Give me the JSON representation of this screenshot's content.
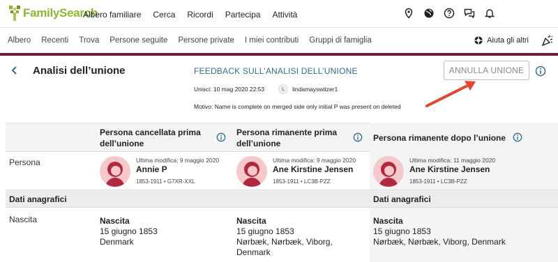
{
  "brand": {
    "name": "FamilySearch",
    "color": "#8cb92b"
  },
  "top_menu": [
    "Albero familiare",
    "Cerca",
    "Ricordi",
    "Partecipa",
    "Attività"
  ],
  "top_icons": [
    "location-icon",
    "globe-icon",
    "help-icon",
    "chat-icon",
    "bell-icon"
  ],
  "sub_menu": [
    "Albero",
    "Recenti",
    "Trova",
    "Persone seguite",
    "Persone private",
    "I miei contributi",
    "Gruppi di famiglia"
  ],
  "help_others": "Aiuta gli altri",
  "page": {
    "title": "Analisi dell’unione",
    "feedback_link": "FEEDBACK SULL’ANALISI DELL’UNIONE",
    "undo_button": "ANNULLA UNIONE",
    "merged_label": "Unisci: 10 mag 2020 22:53",
    "user_initial": "L",
    "user_name": "lindamayswitzer1",
    "reason": "Motivo: Name is complete on merged side only initial P was present on deleted"
  },
  "table": {
    "columns": [
      "Persona cancellata prima dell’unione",
      "Persona rimanente prima dell’unione",
      "Persona rimanente dopo l’unione"
    ],
    "row_person_label": "Persona",
    "persons": [
      {
        "modified": "Ultima modifica: 9 maggio 2020",
        "name": "Annie P",
        "ids": "1853-1911 • G7XR-XXL"
      },
      {
        "modified": "Ultima modifica: 9 maggio 2020",
        "name": "Ane Kirstine Jensen",
        "ids": "1853-1911 • LC3B-PZZ"
      },
      {
        "modified": "Ultima modifica: 11 maggio 2020",
        "name": "Ane Kirstine Jensen",
        "ids": "1853-1911 • LC3B-PZZ"
      }
    ],
    "section_label": "Dati anagrafici",
    "birth_row_label": "Nascita",
    "births": [
      {
        "type": "Nascita",
        "date": "15 giugno 1853",
        "place1": "Denmark",
        "place2": ""
      },
      {
        "type": "Nascita",
        "date": "15 giugno 1853",
        "place1": "Nørbæk, Nørbæk, Viborg,",
        "place2": "Denmark"
      },
      {
        "type": "Nascita",
        "date": "15 giugno 1853",
        "place1": "Nørbæk, Nørbæk, Viborg, Denmark",
        "place2": ""
      }
    ]
  },
  "colors": {
    "accent_bar": "#7a1a3a",
    "link": "#2f6f8f",
    "arrow": "#e8442e",
    "avatar": "#f5c9c9"
  }
}
